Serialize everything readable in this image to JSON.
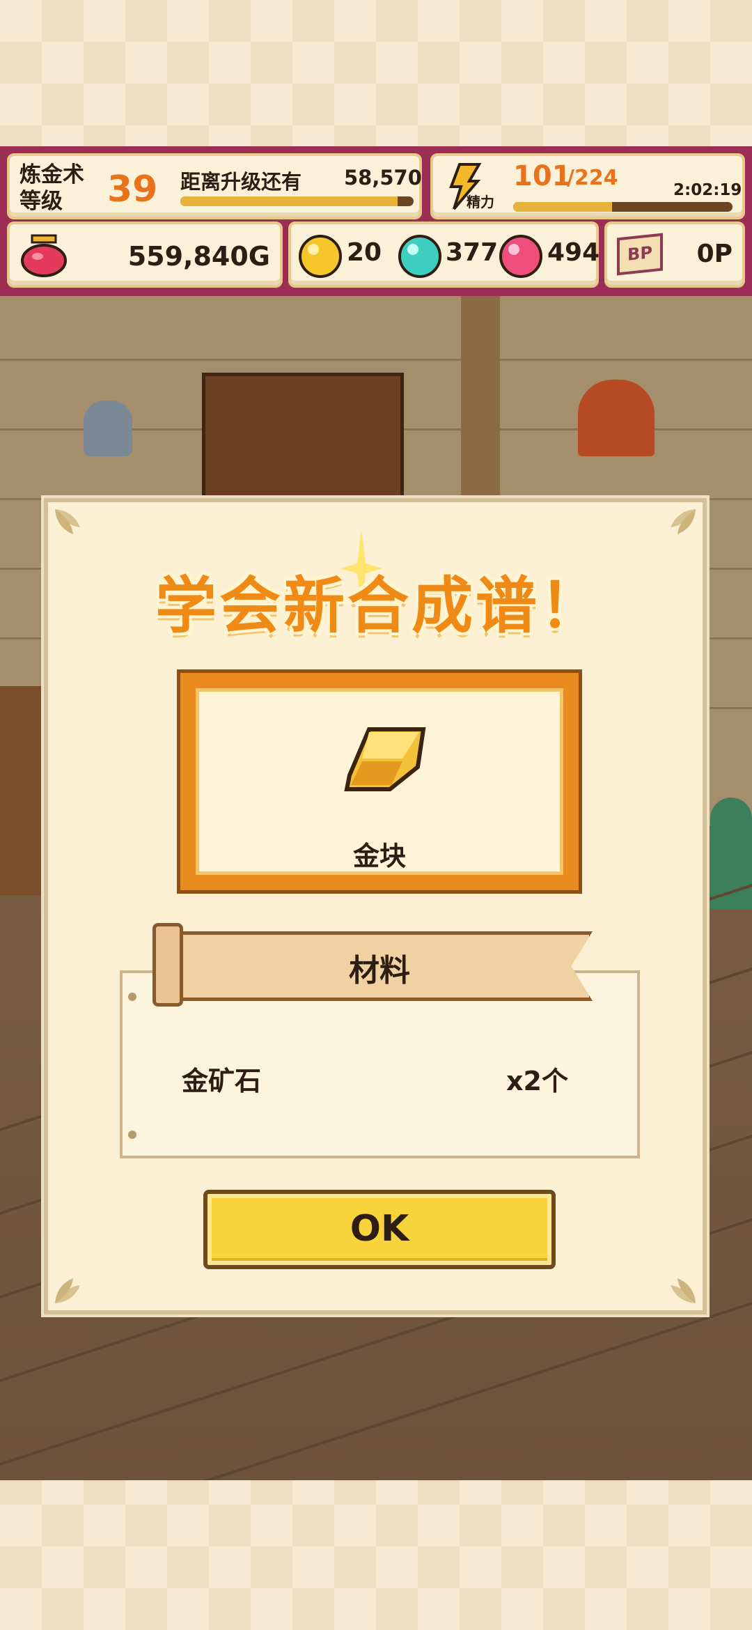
{
  "hud": {
    "level_title": "炼金术等级",
    "level": "39",
    "next_level_label": "距离升级还有",
    "next_level_value": "58,570",
    "next_level_progress": 0.93,
    "stamina_label": "精力",
    "stamina_current": "101",
    "stamina_max": "/224",
    "stamina_timer": "2:02:19",
    "stamina_progress": 0.45,
    "gold": "559,840G",
    "gem_yellow": "20",
    "gem_cyan": "377",
    "gem_pink": "494",
    "bp_icon_label": "BP",
    "bp_value": "0P"
  },
  "modal": {
    "title": "学会新合成谱！",
    "item_name": "金块",
    "materials_header": "材料",
    "materials": [
      {
        "name": "金矿石",
        "qty": "x2个"
      }
    ],
    "ok_label": "OK"
  },
  "colors": {
    "hud_bg": "#9c2d55",
    "accent_orange": "#e8731a",
    "ok_yellow": "#f7d33c"
  }
}
